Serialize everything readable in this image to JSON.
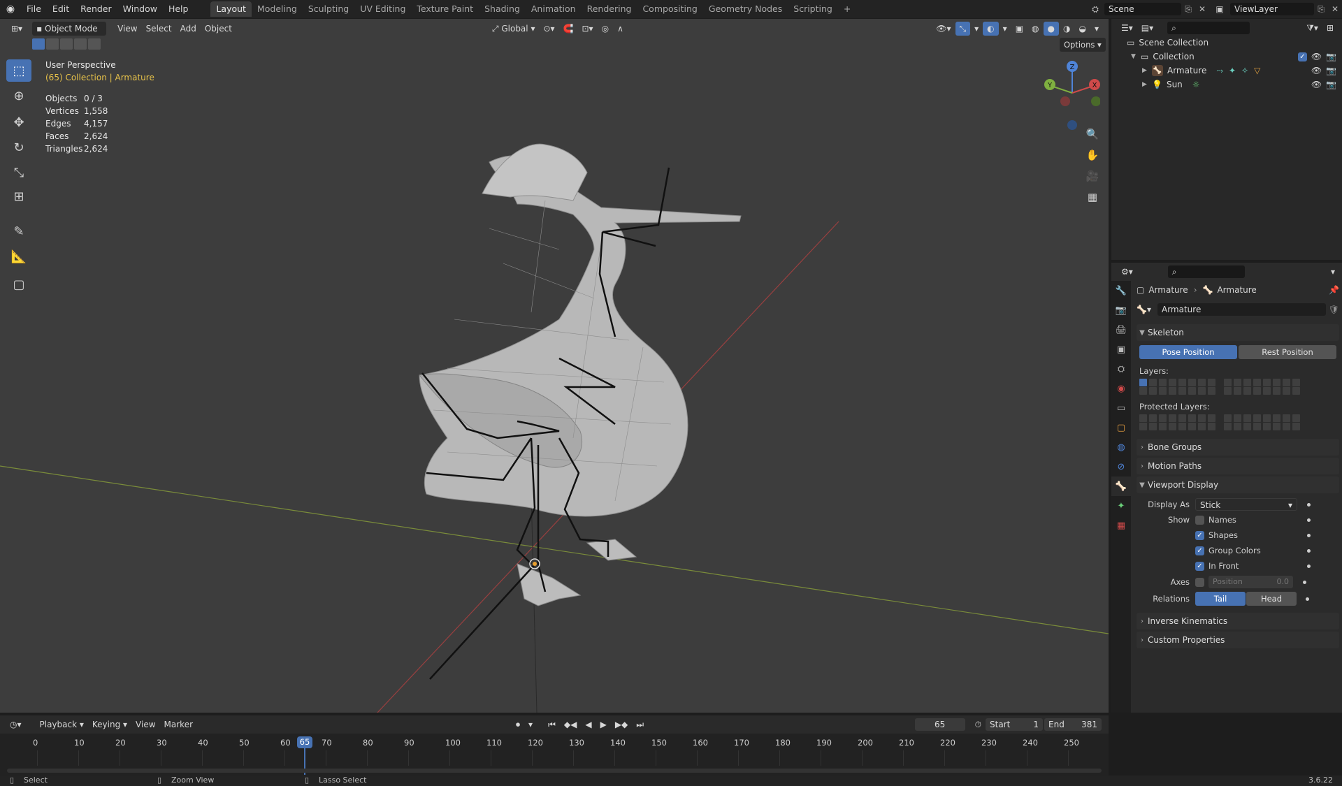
{
  "topbar": {
    "menus": [
      "File",
      "Edit",
      "Render",
      "Window",
      "Help"
    ],
    "workspace_tabs": [
      "Layout",
      "Modeling",
      "Sculpting",
      "UV Editing",
      "Texture Paint",
      "Shading",
      "Animation",
      "Rendering",
      "Compositing",
      "Geometry Nodes",
      "Scripting"
    ],
    "active_tab": "Layout",
    "add_tab": "+",
    "scene_name": "Scene",
    "view_layer": "ViewLayer"
  },
  "viewport": {
    "mode": "Object Mode",
    "menus": [
      "View",
      "Select",
      "Add",
      "Object"
    ],
    "transform_orientation": "Global",
    "options_label": "Options",
    "perspective_label": "User Perspective",
    "collection_prefix": "(65) Collection | ",
    "active_object": "Armature",
    "stats": [
      {
        "label": "Objects",
        "value": "0 / 3"
      },
      {
        "label": "Vertices",
        "value": "1,558"
      },
      {
        "label": "Edges",
        "value": "4,157"
      },
      {
        "label": "Faces",
        "value": "2,624"
      },
      {
        "label": "Triangles",
        "value": "2,624"
      }
    ],
    "gizmo": {
      "z": "Z",
      "y": "Y",
      "x": "X"
    }
  },
  "outliner": {
    "search_placeholder": "",
    "scene_collection": "Scene Collection",
    "collection": "Collection",
    "items": [
      {
        "name": "Armature"
      },
      {
        "name": "Sun"
      }
    ]
  },
  "properties": {
    "breadcrumb_1": "Armature",
    "breadcrumb_2": "Armature",
    "data_name": "Armature",
    "skeleton": {
      "title": "Skeleton",
      "pose_position": "Pose Position",
      "rest_position": "Rest Position",
      "layers_label": "Layers:",
      "protected_layers_label": "Protected Layers:"
    },
    "collapsed_panels": [
      "Bone Groups",
      "Motion Paths"
    ],
    "viewport_display": {
      "title": "Viewport Display",
      "display_as_label": "Display As",
      "display_as_value": "Stick",
      "show_label": "Show",
      "names": "Names",
      "shapes": "Shapes",
      "group_colors": "Group Colors",
      "in_front": "In Front",
      "names_checked": false,
      "shapes_checked": true,
      "group_colors_checked": true,
      "in_front_checked": true,
      "axes_label": "Axes",
      "position_label": "Position",
      "position_value": "0.0",
      "relations_label": "Relations",
      "tail": "Tail",
      "head": "Head"
    },
    "bottom_panels": [
      "Inverse Kinematics",
      "Custom Properties"
    ]
  },
  "timeline": {
    "menus": [
      "Playback",
      "Keying",
      "View",
      "Marker"
    ],
    "current_frame": "65",
    "start_label": "Start",
    "start_value": "1",
    "end_label": "End",
    "end_value": "381",
    "ruler_ticks": [
      "0",
      "10",
      "20",
      "30",
      "40",
      "50",
      "60",
      "70",
      "80",
      "90",
      "100",
      "110",
      "120",
      "130",
      "140",
      "150",
      "160",
      "170",
      "180",
      "190",
      "200",
      "210",
      "220",
      "230",
      "240",
      "250"
    ],
    "playhead_label": "65"
  },
  "statusbar": {
    "select": "Select",
    "zoom_view": "Zoom View",
    "lasso_select": "Lasso Select",
    "version": "3.6.22"
  },
  "colors": {
    "accent": "#4772b3",
    "viewport_bg": "#3d3d3d",
    "active_object": "#e8c34a",
    "x_axis": "#c04040",
    "y_axis": "#8aae3a"
  }
}
